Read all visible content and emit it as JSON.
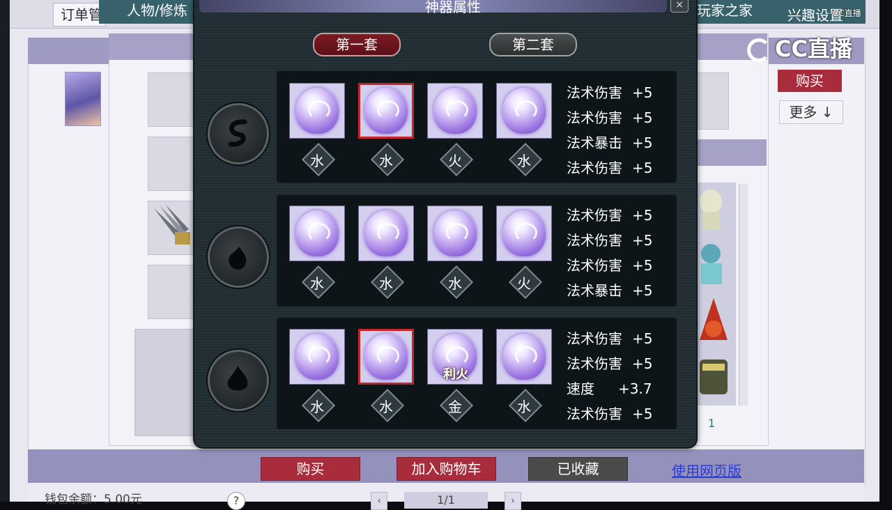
{
  "background": {
    "order_manage": "订单管",
    "nav_items": [
      "人物/修炼",
      "玩家之家",
      "兴趣设置"
    ],
    "buy_button": "购买",
    "more_button": "更多 ↓",
    "count": "1",
    "wallet": "钱包余额：5.00元",
    "help": "?",
    "pager": "1/1",
    "prev": "‹",
    "next": "›"
  },
  "watermark": {
    "brand": "CC直播",
    "small": "CC直播"
  },
  "dialog": {
    "title": "神器属性",
    "close": "×",
    "tabs": [
      {
        "label": "第一套",
        "active": true
      },
      {
        "label": "第二套",
        "active": false
      }
    ],
    "groups": [
      {
        "slots": [
          {
            "element": "水",
            "selected": false,
            "tag": ""
          },
          {
            "element": "水",
            "selected": true,
            "tag": ""
          },
          {
            "element": "火",
            "selected": false,
            "tag": ""
          },
          {
            "element": "水",
            "selected": false,
            "tag": ""
          }
        ],
        "stats": [
          {
            "name": "法术伤害",
            "value": "+5"
          },
          {
            "name": "法术伤害",
            "value": "+5"
          },
          {
            "name": "法术暴击",
            "value": "+5"
          },
          {
            "name": "法术伤害",
            "value": "+5"
          }
        ]
      },
      {
        "slots": [
          {
            "element": "水",
            "selected": false,
            "tag": ""
          },
          {
            "element": "水",
            "selected": false,
            "tag": ""
          },
          {
            "element": "水",
            "selected": false,
            "tag": ""
          },
          {
            "element": "火",
            "selected": false,
            "tag": ""
          }
        ],
        "stats": [
          {
            "name": "法术伤害",
            "value": "+5"
          },
          {
            "name": "法术伤害",
            "value": "+5"
          },
          {
            "name": "法术伤害",
            "value": "+5"
          },
          {
            "name": "法术暴击",
            "value": "+5"
          }
        ]
      },
      {
        "slots": [
          {
            "element": "水",
            "selected": false,
            "tag": ""
          },
          {
            "element": "水",
            "selected": true,
            "tag": ""
          },
          {
            "element": "金",
            "selected": false,
            "tag": "利火"
          },
          {
            "element": "水",
            "selected": false,
            "tag": ""
          }
        ],
        "stats": [
          {
            "name": "法术伤害",
            "value": "+5"
          },
          {
            "name": "法术伤害",
            "value": "+5"
          },
          {
            "name": "速度",
            "value": "+3.7"
          },
          {
            "name": "法术伤害",
            "value": "+5"
          }
        ]
      }
    ]
  },
  "footer_buttons": {
    "buy": "购买",
    "add_cart": "加入购物车",
    "favorited": "已收藏",
    "web_version": "使用网页版"
  },
  "colors": {
    "accent_red": "#a82c3c",
    "dialog_bg": "#253238",
    "gem_purple": "#9a73e0",
    "link_blue": "#2b3cd6"
  }
}
